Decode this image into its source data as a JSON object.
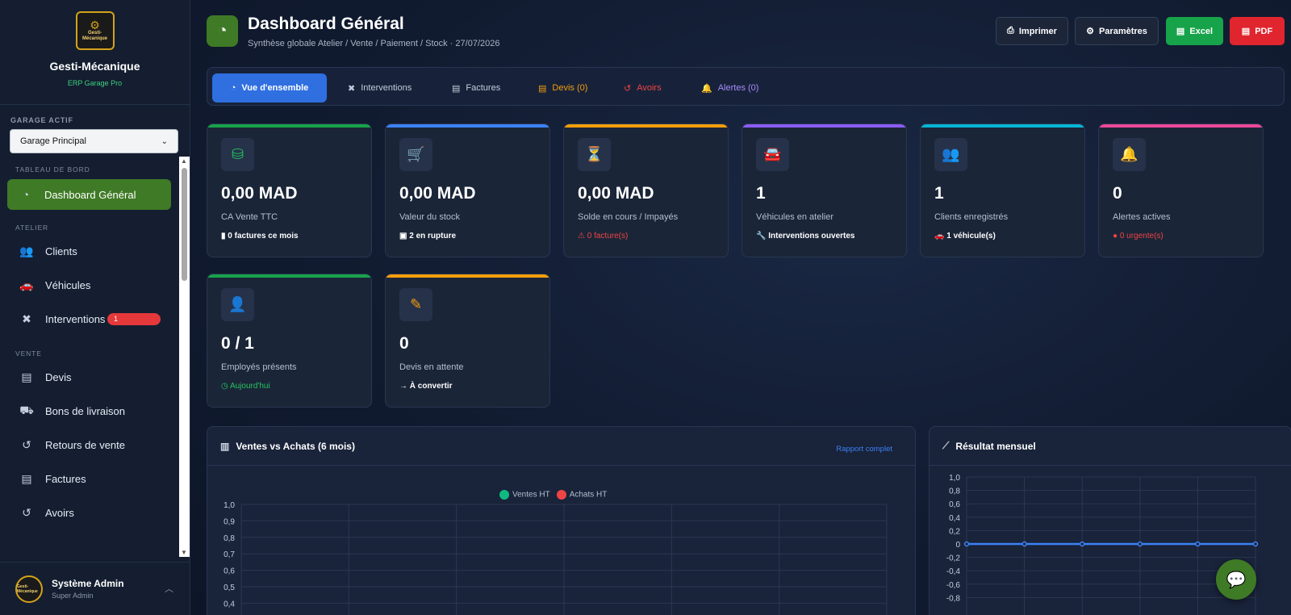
{
  "brand": {
    "logo_text": "Gesti-Mécanique",
    "name": "Gesti-Mécanique",
    "subtitle": "ERP Garage Pro"
  },
  "garage": {
    "label": "GARAGE ACTIF",
    "selected": "Garage Principal"
  },
  "nav": {
    "section_dashboard": "TABLEAU DE BORD",
    "dashboard": "Dashboard Général",
    "section_atelier": "ATELIER",
    "clients": "Clients",
    "vehicules": "Véhicules",
    "interventions": "Interventions",
    "interventions_badge": "1",
    "section_vente": "VENTE",
    "devis": "Devis",
    "bons": "Bons de livraison",
    "retours": "Retours de vente",
    "factures": "Factures",
    "avoirs": "Avoirs"
  },
  "user": {
    "avatar_text": "Gesti-Mécanique",
    "name": "Système Admin",
    "role": "Super Admin"
  },
  "header": {
    "title": "Dashboard Général",
    "subtitle": "Synthèse globale Atelier / Vente / Paiement / Stock · 27/07/2026"
  },
  "toolbar": {
    "print": "Imprimer",
    "params": "Paramètres",
    "excel": "Excel",
    "pdf": "PDF"
  },
  "tabs": {
    "overview": "Vue d'ensemble",
    "interventions": "Interventions",
    "factures": "Factures",
    "devis": "Devis (0)",
    "avoirs": "Avoirs",
    "alertes": "Alertes (0)"
  },
  "colors": {
    "green": "#17a34a",
    "blue": "#2f6fe0",
    "orange": "#f59e0b",
    "purple": "#8b5cf6",
    "cyan": "#06b6d4",
    "pink": "#ec4899",
    "red": "#e5383b"
  },
  "cards": [
    {
      "icon": "coins-icon",
      "value": "0,00 MAD",
      "label": "CA Vente TTC",
      "note": "0 factures ce mois"
    },
    {
      "icon": "cart-icon",
      "value": "0,00 MAD",
      "label": "Valeur du stock",
      "note": "2 en rupture"
    },
    {
      "icon": "hourglass-icon",
      "value": "0,00 MAD",
      "label": "Solde en cours / Impayés",
      "note": "0 facture(s)"
    },
    {
      "icon": "car-icon",
      "value": "1",
      "label": "Véhicules en atelier",
      "note": "Interventions ouvertes"
    },
    {
      "icon": "users-icon",
      "value": "1",
      "label": "Clients enregistrés",
      "note": "1 véhicule(s)"
    },
    {
      "icon": "bell-icon",
      "value": "0",
      "label": "Alertes actives",
      "note": "0 urgente(s)"
    },
    {
      "icon": "user-cog-icon",
      "value": "0 / 1",
      "label": "Employés présents",
      "note": "Aujourd'hui"
    },
    {
      "icon": "file-edit-icon",
      "value": "0",
      "label": "Devis en attente",
      "note": "À convertir"
    }
  ],
  "chart_data": [
    {
      "type": "line",
      "title": "Ventes vs Achats (6 mois)",
      "link": "Rapport complet",
      "series": [
        {
          "name": "Ventes HT",
          "values": []
        },
        {
          "name": "Achats HT",
          "values": []
        }
      ],
      "yticks": [
        "1,0",
        "0,9",
        "0,8",
        "0,7",
        "0,6",
        "0,5",
        "0,4"
      ],
      "ylim": [
        0,
        1
      ],
      "grid": true,
      "legend": "top"
    },
    {
      "type": "line",
      "title": "Résultat mensuel",
      "series": [
        {
          "values": [
            0,
            0,
            0,
            0,
            0,
            0
          ]
        }
      ],
      "yticks": [
        "1,0",
        "0,8",
        "0,6",
        "0,4",
        "0,2",
        "0",
        "-0,2",
        "-0,4",
        "-0,6",
        "-0,8"
      ],
      "ylim": [
        -1,
        1
      ],
      "grid": true
    }
  ]
}
